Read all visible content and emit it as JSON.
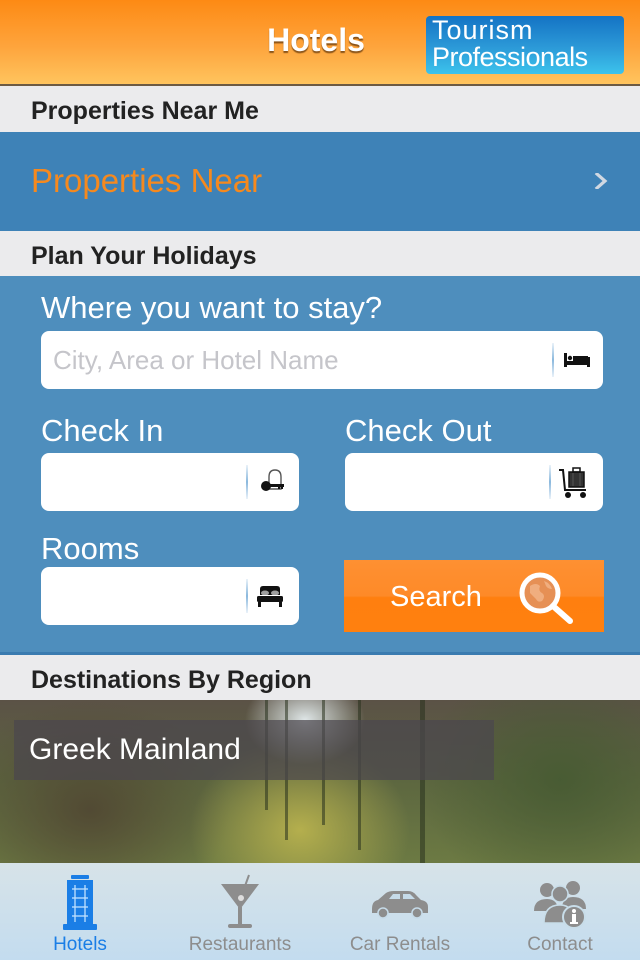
{
  "header": {
    "title": "Hotels",
    "brand_line1": "Tourism",
    "brand_line2": "Professionals"
  },
  "sections": {
    "near_me": {
      "heading": "Properties Near Me",
      "row_label": "Properties Near",
      "chevron_icon": "chevron-right-icon"
    },
    "plan": {
      "heading": "Plan Your Holidays",
      "where_label": "Where you want to stay?",
      "where_placeholder": "City, Area or Hotel Name",
      "where_value": "",
      "where_icon": "bed-icon",
      "checkin_label": "Check In",
      "checkin_value": "",
      "checkin_icon": "key-icon",
      "checkout_label": "Check Out",
      "checkout_value": "",
      "checkout_icon": "luggage-cart-icon",
      "rooms_label": "Rooms",
      "rooms_value": "",
      "rooms_icon": "double-bed-icon",
      "search_label": "Search",
      "search_icon": "globe-search-icon"
    },
    "regions": {
      "heading": "Destinations By Region",
      "items": [
        {
          "label": "Greek Mainland"
        }
      ]
    }
  },
  "tabbar": {
    "active": "Hotels",
    "items": [
      {
        "label": "Hotels",
        "icon": "building-icon"
      },
      {
        "label": "Restaurants",
        "icon": "cocktail-icon"
      },
      {
        "label": "Car Rentals",
        "icon": "car-icon"
      },
      {
        "label": "Contact",
        "icon": "contact-info-icon"
      }
    ]
  },
  "colors": {
    "header_orange": "#fd8a14",
    "panel_blue": "#4e8ebd",
    "row_blue": "#3e82b7",
    "accent_orange": "#f5891e",
    "active_tab_blue": "#1a7ee6",
    "inactive_tab_gray": "#8d8d8d"
  }
}
